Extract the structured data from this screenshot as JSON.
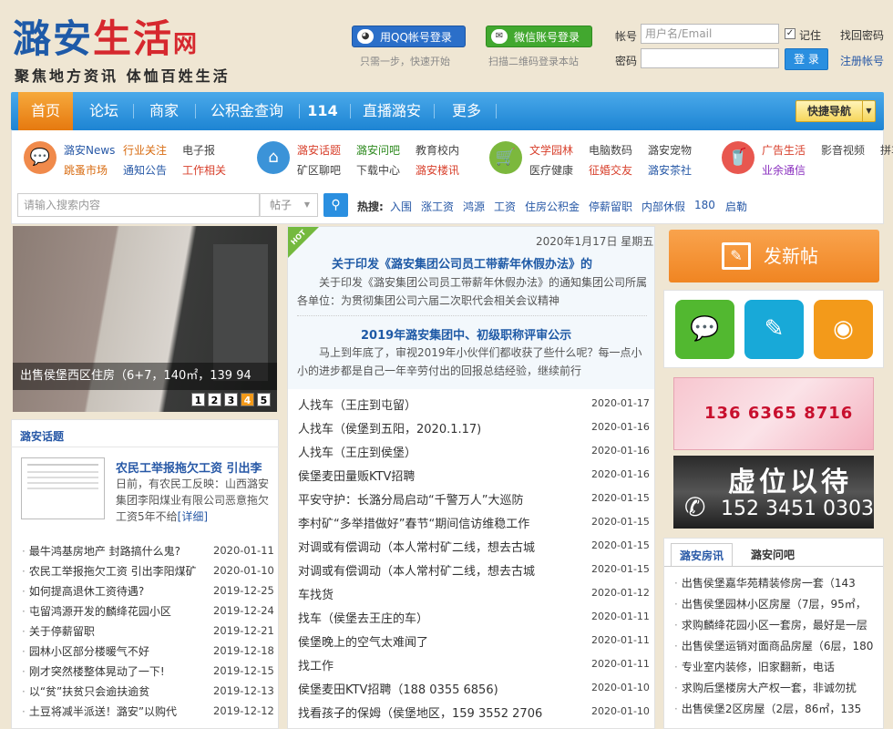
{
  "logo": {
    "name_part1": "潞安",
    "name_part2": "生活",
    "net": "网",
    "slogan": "聚焦地方资讯 体恤百姓生活"
  },
  "login": {
    "qq_label": "用QQ帐号登录",
    "qq_tip": "只需一步，快速开始",
    "wechat_label": "微信账号登录",
    "wechat_tip": "扫描二维码登录本站",
    "account_label": "帐号",
    "account_placeholder": "用户名/Email",
    "password_label": "密码",
    "remember_label": "记住",
    "remember_checked": "✓",
    "forgot_label": "找回密码",
    "login_button": "登 录",
    "register_label": "注册帐号"
  },
  "nav": {
    "items": [
      "首页",
      "论坛",
      "商家",
      "公积金查询",
      "114",
      "直播潞安",
      "更多"
    ],
    "quick_nav": "快捷导航"
  },
  "categories": [
    {
      "icon": "💬",
      "color": "#f08a4b",
      "links": [
        [
          "潞安News",
          "c-blue"
        ],
        [
          "行业关注",
          "c-org"
        ],
        [
          "电子报",
          "c-gray"
        ],
        [
          "跳蚤市场",
          "c-org"
        ],
        [
          "通知公告",
          "c-blue"
        ],
        [
          "工作相关",
          "c-red"
        ]
      ]
    },
    {
      "icon": "⌂",
      "color": "#3b93d8",
      "links": [
        [
          "潞安话题",
          "c-red"
        ],
        [
          "潞安问吧",
          "c-green"
        ],
        [
          "教育校内",
          "c-gray"
        ],
        [
          "矿区聊吧",
          "c-gray"
        ],
        [
          "下载中心",
          "c-gray"
        ],
        [
          "潞安楼讯",
          "c-red"
        ]
      ]
    },
    {
      "icon": "🛒",
      "color": "#7cb83d",
      "links": [
        [
          "文学园林",
          "c-red"
        ],
        [
          "电脑数码",
          "c-gray"
        ],
        [
          "潞安宠物",
          "c-gray"
        ],
        [
          "医疗健康",
          "c-gray"
        ],
        [
          "征婚交友",
          "c-red"
        ],
        [
          "潞安茶社",
          "c-blue"
        ]
      ]
    },
    {
      "icon": "🥤",
      "color": "#e8574f",
      "links": [
        [
          "广告生活",
          "c-red"
        ],
        [
          "影音视频",
          "c-gray"
        ],
        [
          "拼车便民",
          "c-gray"
        ],
        [
          "业余通信",
          "c-pur"
        ]
      ]
    }
  ],
  "search": {
    "placeholder": "请输入搜索内容",
    "type": "帖子",
    "hot_label": "热搜:",
    "hot_words": [
      "入围",
      "涨工资",
      "鸿源",
      "工资",
      "住房公积金",
      "停薪留职",
      "内部休假",
      "180",
      "启勒"
    ]
  },
  "slideshow": {
    "caption": "出售侯堡西区住房（6+7，140㎡，139 94",
    "pages": [
      "1",
      "2",
      "3",
      "4",
      "5"
    ],
    "active_page": "4"
  },
  "topics": {
    "title": "潞安话题",
    "feature_title": "农民工举报拖欠工资 引出李",
    "feature_text": "日前，有农民工反映：山西潞安集团李阳煤业有限公司恶意拖欠工资5年不给",
    "feature_more": "[详细]",
    "list": [
      [
        "最牛鸿基房地产 封路搞什么鬼?",
        "2020-01-11"
      ],
      [
        "农民工举报拖欠工资 引出李阳煤矿",
        "2020-01-10"
      ],
      [
        "如何提高退休工资待遇?",
        "2019-12-25"
      ],
      [
        "屯留鸿源开发的麟绛花园小区",
        "2019-12-24"
      ],
      [
        "关于停薪留职",
        "2019-12-21"
      ],
      [
        "园林小区部分楼暖气不好",
        "2019-12-18"
      ],
      [
        "刚才突然楼整体晃动了一下!",
        "2019-12-15"
      ],
      [
        "以“贫”扶贫只会逾扶逾贫",
        "2019-12-13"
      ],
      [
        "土豆将减半派送！潞安”以购代",
        "2019-12-12"
      ]
    ]
  },
  "news": {
    "hot_badge": "HOT",
    "date": "2020年1月17日 星期五",
    "headline1": "关于印发《潞安集团公司员工带薪年休假办法》的",
    "summary1": "关于印发《潞安集团公司员工带薪年休假办法》的通知集团公司所属各单位：为贯彻集团公司六届二次职代会相关会议精神",
    "headline2": "2019年潞安集团中、初级职称评审公示",
    "summary2": "马上到年底了，审视2019年小伙伴们都收获了些什么呢？每一点小小的进步都是自己一年辛劳付出的回报总结经验，继续前行",
    "list": [
      [
        "人找车（王庄到屯留）",
        "2020-01-17"
      ],
      [
        "人找车（侯堡到五阳，2020.1.17)",
        "2020-01-16"
      ],
      [
        "人找车（王庄到侯堡）",
        "2020-01-16"
      ],
      [
        "侯堡麦田量贩KTV招聘",
        "2020-01-16"
      ],
      [
        "平安守护：长潞分局启动“千警万人”大巡防",
        "2020-01-15"
      ],
      [
        "李村矿“多举措做好”春节“期间信访维稳工作",
        "2020-01-15"
      ],
      [
        "对调或有偿调动（本人常村矿二线，想去古城",
        "2020-01-15"
      ],
      [
        "对调或有偿调动（本人常村矿二线，想去古城",
        "2020-01-15"
      ],
      [
        "车找货",
        "2020-01-12"
      ],
      [
        "找车（侯堡去王庄的车）",
        "2020-01-11"
      ],
      [
        "侯堡晚上的空气太难闻了",
        "2020-01-11"
      ],
      [
        "找工作",
        "2020-01-11"
      ],
      [
        "侯堡麦田KTV招聘（188 0355 6856)",
        "2020-01-10"
      ],
      [
        "找看孩子的保姆（侯堡地区，159 3552 2706",
        "2020-01-10"
      ]
    ]
  },
  "sidebar": {
    "post_button": "发新帖",
    "social": [
      [
        "wechat-icon",
        "💬",
        "#52b830"
      ],
      [
        "weibo-mini-icon",
        "✎",
        "#18a9d8"
      ],
      [
        "weibo-icon",
        "◉",
        "#f39a1a"
      ]
    ],
    "ad1_number": "136 6365 8716",
    "ad2_title": "虚位以待",
    "ad2_number": "152 3451 0303",
    "tabs": [
      "潞安房讯",
      "潞安问吧"
    ],
    "house_list": [
      "出售侯堡嘉华苑精装修房一套（143",
      "出售侯堡园林小区房屋（7层，95㎡，",
      "求购麟绛花园小区一套房，最好是一层",
      "出售侯堡运销对面商品房屋（6层，180",
      "专业室内装修，旧家翻新，电话",
      "求购后堡楼房大产权一套，非诚勿扰",
      "出售侯堡2区房屋（2层，86㎡，135"
    ]
  },
  "colors": {
    "nav_blue": "#1d84d3",
    "accent_orange": "#f08522",
    "link_blue": "#2758a6"
  }
}
